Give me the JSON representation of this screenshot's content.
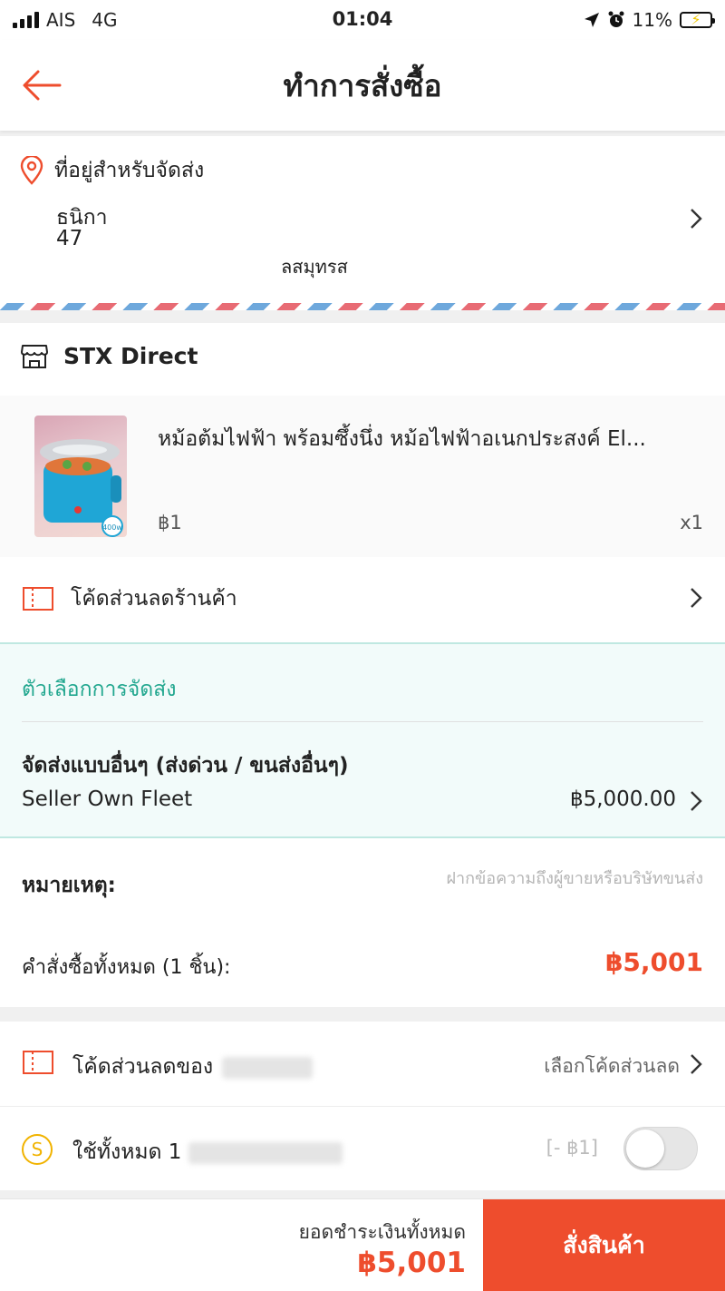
{
  "status_bar": {
    "carrier": "AIS",
    "network": "4G",
    "time": "01:04",
    "battery": "11%"
  },
  "header": {
    "title": "ทำการสั่งซื้อ"
  },
  "address": {
    "label": "ที่อยู่สำหรับจัดส่ง",
    "line1": "ธนิกา",
    "line2": "47",
    "line3": "ลสมุทรส"
  },
  "shop": {
    "name": "STX Direct",
    "product": {
      "name": "หม้อต้มไฟฟ้า พร้อมซึ้งนึ่ง หม้อไฟฟ้าอเนกประสงค์ El...",
      "price": "฿1",
      "quantity": "x1",
      "badge": "400w"
    },
    "voucher_label": "โค้ดส่วนลดร้านค้า"
  },
  "shipping": {
    "section_title": "ตัวเลือกการจัดส่ง",
    "method": "จัดส่งแบบอื่นๆ (ส่งด่วน / ขนส่งอื่นๆ)",
    "carrier": "Seller Own Fleet",
    "price": "฿5,000.00"
  },
  "note": {
    "label": "หมายเหตุ:",
    "placeholder": "ฝากข้อความถึงผู้ขายหรือบริษัทขนส่ง"
  },
  "order_total": {
    "label": "คำสั่งซื้อทั้งหมด (1 ชิ้น):",
    "value": "฿5,001"
  },
  "platform_voucher": {
    "label": "โค้ดส่วนลดของ",
    "select_label": "เลือกโค้ดส่วนลด"
  },
  "coins": {
    "label": "ใช้ทั้งหมด 1",
    "deduction": "[- ฿1]",
    "enabled": false
  },
  "bottom_bar": {
    "total_label": "ยอดชำระเงินทั้งหมด",
    "total_value": "฿5,001",
    "order_button": "สั่งสินค้า"
  },
  "colors": {
    "accent": "#ee4d2d",
    "shipping_teal": "#22a78f",
    "coin_yellow": "#f1b300"
  }
}
